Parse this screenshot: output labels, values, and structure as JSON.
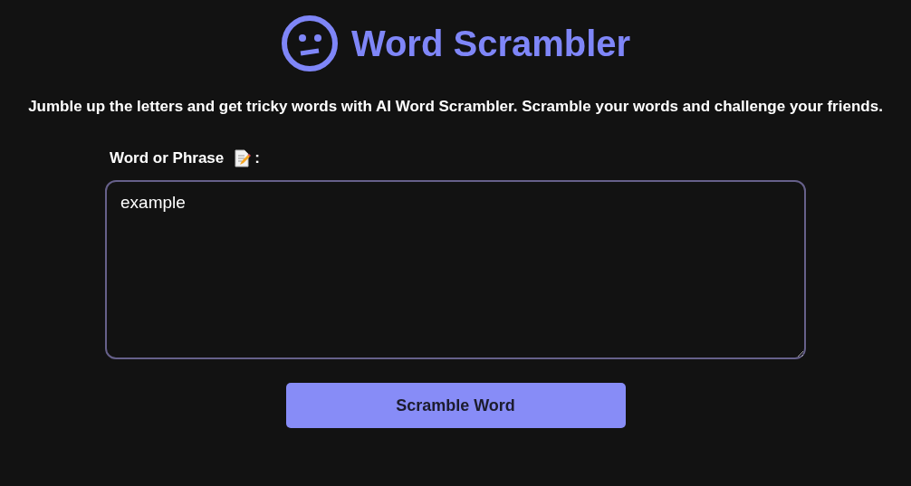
{
  "title": "Word Scrambler",
  "description": "Jumble up the letters and get tricky words with AI Word Scrambler. Scramble your words and challenge your friends.",
  "input": {
    "label": "Word or Phrase",
    "label_suffix": ":",
    "value": "example"
  },
  "button": {
    "label": "Scramble Word"
  }
}
